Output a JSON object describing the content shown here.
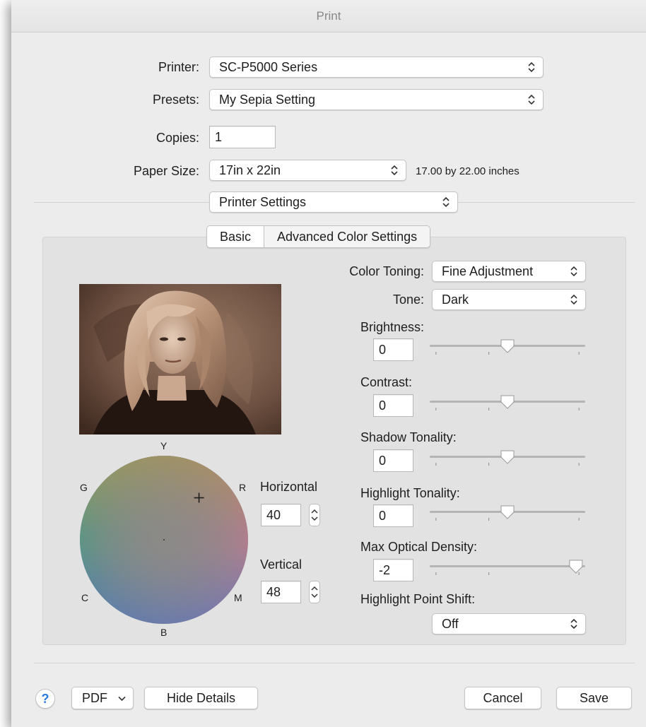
{
  "window": {
    "title": "Print"
  },
  "printer": {
    "label": "Printer:",
    "value": "SC-P5000 Series"
  },
  "presets": {
    "label": "Presets:",
    "value": "My Sepia Setting"
  },
  "copies": {
    "label": "Copies:",
    "value": "1"
  },
  "paper_size": {
    "label": "Paper Size:",
    "value": "17in x 22in",
    "dimensions": "17.00 by 22.00 inches"
  },
  "section_popup": {
    "value": "Printer Settings"
  },
  "tabs": [
    {
      "label": "Basic",
      "selected": true
    },
    {
      "label": "Advanced Color Settings",
      "selected": false
    }
  ],
  "color_toning": {
    "label": "Color Toning:",
    "value": "Fine Adjustment"
  },
  "tone": {
    "label": "Tone:",
    "value": "Dark"
  },
  "sliders": [
    {
      "label": "Brightness:",
      "value": "0",
      "position": 0.5
    },
    {
      "label": "Contrast:",
      "value": "0",
      "position": 0.5
    },
    {
      "label": "Shadow Tonality:",
      "value": "0",
      "position": 0.5
    },
    {
      "label": "Highlight Tonality:",
      "value": "0",
      "position": 0.5
    },
    {
      "label": "Max Optical Density:",
      "value": "-2",
      "position": 0.94
    }
  ],
  "highlight_point_shift": {
    "label": "Highlight Point Shift:",
    "value": "Off"
  },
  "color_wheel": {
    "labels": {
      "top": "Y",
      "top_left": "G",
      "top_right": "R",
      "bottom_left": "C",
      "bottom_right": "M",
      "bottom": "B"
    },
    "marker_horizontal": 40,
    "marker_vertical": 48
  },
  "horizontal": {
    "label": "Horizontal",
    "value": "40"
  },
  "vertical": {
    "label": "Vertical",
    "value": "48"
  },
  "footer": {
    "help": "?",
    "pdf": "PDF",
    "hide_details": "Hide Details",
    "cancel": "Cancel",
    "save": "Save"
  },
  "colors": {
    "accent": "#2a7ae2",
    "panel": "#e2e2e2",
    "window": "#ececec"
  },
  "icons": [
    "updown-chevron-icon",
    "help-icon",
    "chevron-down-icon",
    "crosshair-icon"
  ]
}
